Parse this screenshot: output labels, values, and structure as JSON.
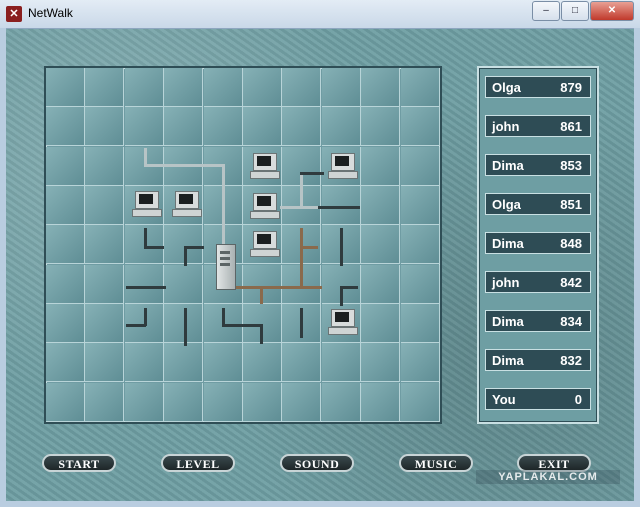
{
  "window": {
    "title": "NetWalk",
    "controls": {
      "minimize": "–",
      "maximize": "□",
      "close": "✕"
    }
  },
  "scores": [
    {
      "name": "Olga",
      "score": "879"
    },
    {
      "name": "john",
      "score": "861"
    },
    {
      "name": "Dima",
      "score": "853"
    },
    {
      "name": "Olga",
      "score": "851"
    },
    {
      "name": "Dima",
      "score": "848"
    },
    {
      "name": "john",
      "score": "842"
    },
    {
      "name": "Dima",
      "score": "834"
    },
    {
      "name": "Dima",
      "score": "832"
    },
    {
      "name": "You",
      "score": "0"
    }
  ],
  "buttons": {
    "start": "START",
    "level": "LEVEL",
    "sound": "SOUND",
    "music": "MUSIC",
    "exit": "EXIT"
  },
  "watermark": "YAPLAKAL.COM",
  "board": {
    "cols": 10,
    "rows": 9
  }
}
